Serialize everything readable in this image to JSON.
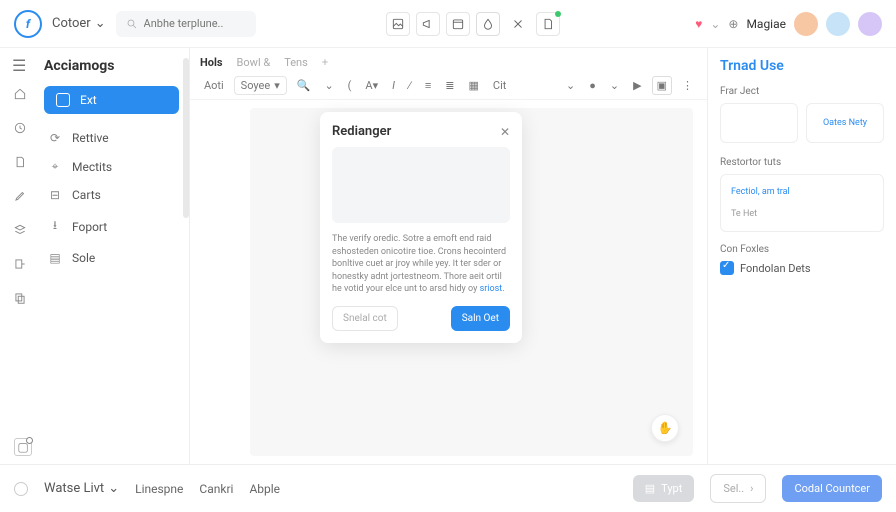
{
  "top": {
    "workspace": "Cotoer",
    "search_placeholder": "Anbhe terplune..",
    "username": "Magiae"
  },
  "sidebar": {
    "title": "Acciamogs",
    "primary": "Ext",
    "items": [
      "Rettive",
      "Mectits",
      "Carts",
      "Foport",
      "Sole"
    ]
  },
  "tabs": [
    "Hols",
    "Bowl &",
    "Tens"
  ],
  "toolbar": {
    "first": "Aoti",
    "select": "Soyee",
    "action": "Cit"
  },
  "modal": {
    "title": "Redianger",
    "body": "The verify oredic. Sotre a emoft end raid eshosteden onicotire tioe. Crons hecointerd bonltive cuet ar jroy while yey. It ter sder or honestky adnt jortestneom. Thore aeit ortil he votid your elce unt to arsd hidy oy",
    "link": "sriost",
    "cancel": "Snelal cot",
    "confirm": "Saln Oet"
  },
  "right": {
    "title": "Trnad Use",
    "section1": "Frar Ject",
    "cardB": "Oates Nety",
    "section2": "Restortor tuts",
    "item1": "Fectiol, am tral",
    "item2": "Te Het",
    "section3": "Con Foxles",
    "check": "Fondolan Dets"
  },
  "bottom": {
    "status": "Watse Livt",
    "a": "Linespne",
    "b": "Cankri",
    "c": "Abple",
    "btn1": "Typt",
    "btn2": "Sel..",
    "btn3": "Codal Countcer"
  }
}
